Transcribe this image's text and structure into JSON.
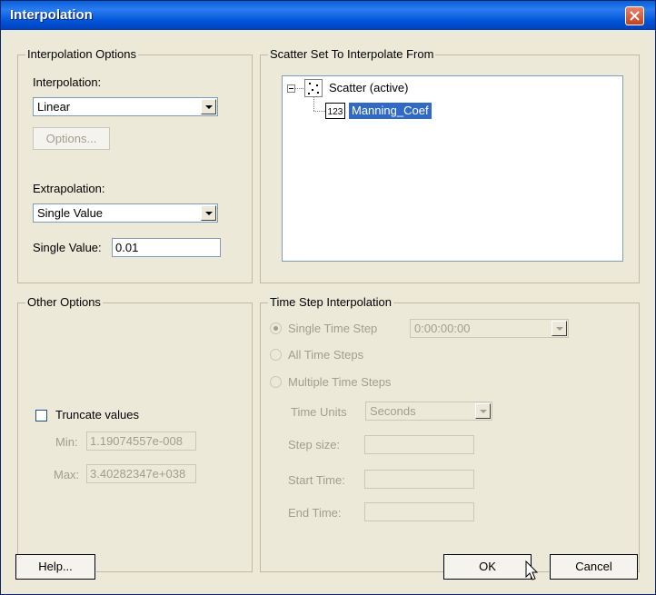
{
  "window": {
    "title": "Interpolation"
  },
  "interpolation_options": {
    "group_label": "Interpolation Options",
    "interpolation_label": "Interpolation:",
    "interpolation_value": "Linear",
    "options_button": "Options...",
    "extrapolation_label": "Extrapolation:",
    "extrapolation_value": "Single Value",
    "single_value_label": "Single Value:",
    "single_value": "0.01"
  },
  "scatter_set": {
    "group_label": "Scatter Set To Interpolate From",
    "root_label": "Scatter (active)",
    "child_label": "Manning_Coef",
    "root_icon": "scatter-points-icon",
    "child_icon": "dataset-123-icon"
  },
  "other_options": {
    "group_label": "Other Options",
    "truncate_label": "Truncate values",
    "truncate_checked": false,
    "min_label": "Min:",
    "min_value": "1.19074557e-008",
    "max_label": "Max:",
    "max_value": "3.40282347e+038"
  },
  "time_step": {
    "group_label": "Time Step Interpolation",
    "single_label": "Single Time Step",
    "single_value": "0:00:00:00",
    "all_label": "All Time Steps",
    "multiple_label": "Multiple Time Steps",
    "units_label": "Time Units",
    "units_value": "Seconds",
    "step_size_label": "Step size:",
    "start_time_label": "Start Time:",
    "end_time_label": "End Time:"
  },
  "buttons": {
    "help": "Help...",
    "ok": "OK",
    "cancel": "Cancel"
  },
  "colors": {
    "title_bar": "#0a5fd6",
    "selection": "#316ac5",
    "dialog_bg": "#ece9d8",
    "close": "#c5401f"
  }
}
